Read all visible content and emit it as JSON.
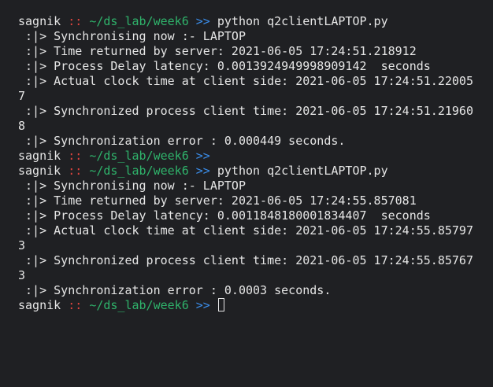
{
  "prompt": {
    "user": "sagnik",
    "separator": "::",
    "path": "~/ds_lab/week6",
    "arrow": ">>"
  },
  "lines": [
    {
      "type": "prompt",
      "command": "python q2clientLAPTOP.py"
    },
    {
      "type": "out",
      "text": " :|> Synchronising now :- LAPTOP"
    },
    {
      "type": "out",
      "text": " :|> Time returned by server: 2021-06-05 17:24:51.218912"
    },
    {
      "type": "out",
      "text": " :|> Process Delay latency: 0.0013924949998909142  seconds"
    },
    {
      "type": "out",
      "text": " :|> Actual clock time at client side: 2021-06-05 17:24:51.22005"
    },
    {
      "type": "out",
      "text": "7"
    },
    {
      "type": "out",
      "text": " :|> Synchronized process client time: 2021-06-05 17:24:51.21960"
    },
    {
      "type": "out",
      "text": "8"
    },
    {
      "type": "out",
      "text": " :|> Synchronization error : 0.000449 seconds."
    },
    {
      "type": "prompt",
      "command": ""
    },
    {
      "type": "prompt",
      "command": "python q2clientLAPTOP.py"
    },
    {
      "type": "out",
      "text": " :|> Synchronising now :- LAPTOP"
    },
    {
      "type": "out",
      "text": " :|> Time returned by server: 2021-06-05 17:24:55.857081"
    },
    {
      "type": "out",
      "text": " :|> Process Delay latency: 0.0011848180001834407  seconds"
    },
    {
      "type": "out",
      "text": " :|> Actual clock time at client side: 2021-06-05 17:24:55.85797"
    },
    {
      "type": "out",
      "text": "3"
    },
    {
      "type": "out",
      "text": " :|> Synchronized process client time: 2021-06-05 17:24:55.85767"
    },
    {
      "type": "out",
      "text": "3"
    },
    {
      "type": "out",
      "text": " :|> Synchronization error : 0.0003 seconds."
    },
    {
      "type": "prompt",
      "command": "",
      "cursor": true
    }
  ],
  "colors": {
    "background": "#1f2023",
    "text": "#e6e6e6",
    "separator": "#e0443e",
    "path": "#2fb36b",
    "arrow": "#3b8eea"
  }
}
